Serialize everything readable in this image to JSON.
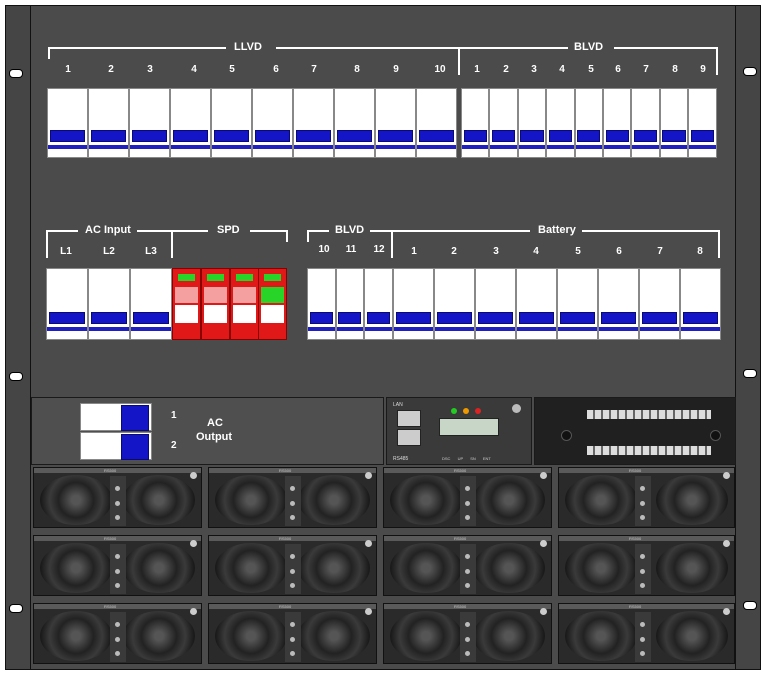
{
  "top_section": {
    "llvd_label": "LLVD",
    "blvd_label": "BLVD",
    "llvd_numbers": [
      "1",
      "2",
      "3",
      "4",
      "5",
      "6",
      "7",
      "8",
      "9",
      "10"
    ],
    "blvd_numbers": [
      "1",
      "2",
      "3",
      "4",
      "5",
      "6",
      "7",
      "8",
      "9"
    ]
  },
  "middle_section": {
    "ac_input_label": "AC Input",
    "ac_input_phases": [
      "L1",
      "L2",
      "L3"
    ],
    "spd_label": "SPD",
    "blvd_label": "BLVD",
    "blvd_numbers": [
      "10",
      "11",
      "12"
    ],
    "battery_label": "Battery",
    "battery_numbers": [
      "1",
      "2",
      "3",
      "4",
      "5",
      "6",
      "7",
      "8"
    ],
    "spd_indicators": [
      "green",
      "green",
      "green",
      "green"
    ]
  },
  "ac_output": {
    "label_line1": "AC",
    "label_line2": "Output",
    "numbers": [
      "1",
      "2"
    ]
  },
  "controller": {
    "lan": "LAN",
    "rs485": "RS485",
    "leds": [
      "DSC",
      "UP",
      "SN",
      "ENT"
    ]
  },
  "rectifiers": {
    "rows": 3,
    "cols": 4,
    "tag": "RS500"
  },
  "colors": {
    "rack": "#4b4b4b",
    "breaker_lever": "#1515c8",
    "spd": "#e01818",
    "spd_window": "#28d428"
  }
}
